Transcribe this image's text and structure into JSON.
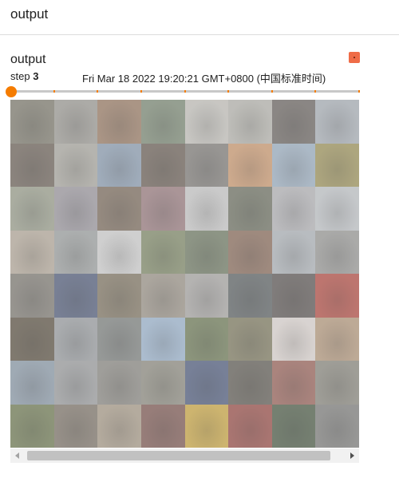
{
  "header": {
    "title": "output"
  },
  "card": {
    "title": "output",
    "step_label": "step",
    "step_value": "3",
    "timestamp": "Fri Mar 18 2022 19:20:21 GMT+0800 (中国标准时间)",
    "expand_icon": "expand-icon",
    "accent_color": "#ef6c47"
  },
  "slider": {
    "color": "#f57c00",
    "current_step": 0,
    "total_steps": 9
  },
  "image_grid": {
    "rows": 8,
    "columns": 8,
    "cells": [
      [
        "#6d6a5c",
        "#8e8c86",
        "#8a6a52",
        "#6b7a64",
        "#b8b6b0",
        "#a9a8a1",
        "#5a5450",
        "#9ca3ab"
      ],
      [
        "#5b5046",
        "#9c9a92",
        "#7b8ea4",
        "#5a4e44",
        "#6f6c68",
        "#c08a5e",
        "#8da1b5",
        "#8f8448"
      ],
      [
        "#8a8f7c",
        "#8c8890",
        "#6b5a4a",
        "#8a6a6e",
        "#bcbcbc",
        "#5c6050",
        "#a6a6aa",
        "#b4b8bc"
      ],
      [
        "#a89c8c",
        "#8e9292",
        "#c4c4c4",
        "#6f7a56",
        "#5e6a52",
        "#7a5a48",
        "#a0a6ac",
        "#8a8a88"
      ],
      [
        "#6e6a62",
        "#3e4a6a",
        "#6f6450",
        "#8c8478",
        "#9a9896",
        "#4a5052",
        "#4a4442",
        "#a83a30"
      ],
      [
        "#4a4030",
        "#8a8e92",
        "#6c706e",
        "#8ca6c2",
        "#5c6a44",
        "#6e6a4e",
        "#d2cac6",
        "#a88a6c"
      ],
      [
        "#7a8a9a",
        "#8c8e90",
        "#7a7872",
        "#7e7c70",
        "#3c4a6e",
        "#4e4a42",
        "#8a5046",
        "#7a786e"
      ],
      [
        "#5e6a40",
        "#6e6458",
        "#9a8c78",
        "#6e4640",
        "#c09a30",
        "#8a3a34",
        "#3a4a34",
        "#6e6e6c"
      ]
    ]
  },
  "scrollbar": {
    "position": 0.0
  }
}
